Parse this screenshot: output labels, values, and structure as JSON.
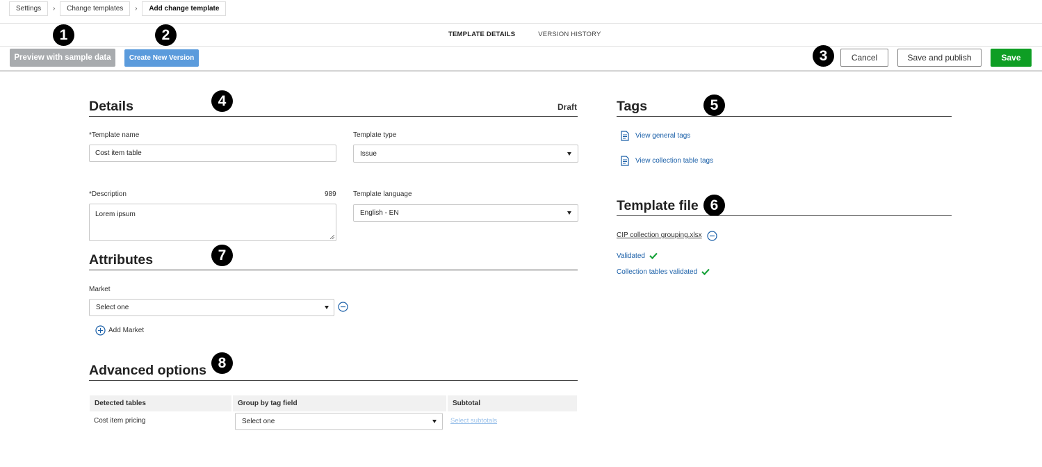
{
  "breadcrumb": [
    "Settings",
    "Change templates",
    "Add change template"
  ],
  "tabs": {
    "details": "TEMPLATE DETAILS",
    "history": "VERSION HISTORY"
  },
  "toolbar": {
    "preview": "Preview with sample data",
    "new_version": "Create New Version",
    "cancel": "Cancel",
    "publish": "Save and publish",
    "save": "Save"
  },
  "markers": [
    "1",
    "2",
    "3",
    "4",
    "5",
    "6",
    "7",
    "8"
  ],
  "details": {
    "title": "Details",
    "status": "Draft",
    "name_label": "*Template name",
    "name_value": "Cost item table",
    "type_label": "Template type",
    "type_value": "Issue",
    "desc_label": "*Description",
    "desc_count": "989",
    "desc_value": "Lorem ipsum",
    "lang_label": "Template language",
    "lang_value": "English - EN"
  },
  "attributes": {
    "title": "Attributes",
    "market_label": "Market",
    "market_value": "Select one",
    "add_market": "Add Market"
  },
  "advanced": {
    "title": "Advanced options",
    "headers": [
      "Detected tables",
      "Group by tag field",
      "Subtotal"
    ],
    "row": {
      "table": "Cost item pricing",
      "group": "Select one",
      "subtotal": "Select subtotals"
    }
  },
  "tags": {
    "title": "Tags",
    "general": "View general tags",
    "collection": "View collection table tags"
  },
  "template_file": {
    "title": "Template file",
    "file_name": "CIP collection grouping.xlsx",
    "validated": "Validated",
    "collection_validated": "Collection tables validated"
  },
  "colors": {
    "accent": "#1a5fa8",
    "save": "#0e9e24",
    "version": "#5b9bdc",
    "preview": "#a8abae",
    "check": "#1aa33c"
  }
}
